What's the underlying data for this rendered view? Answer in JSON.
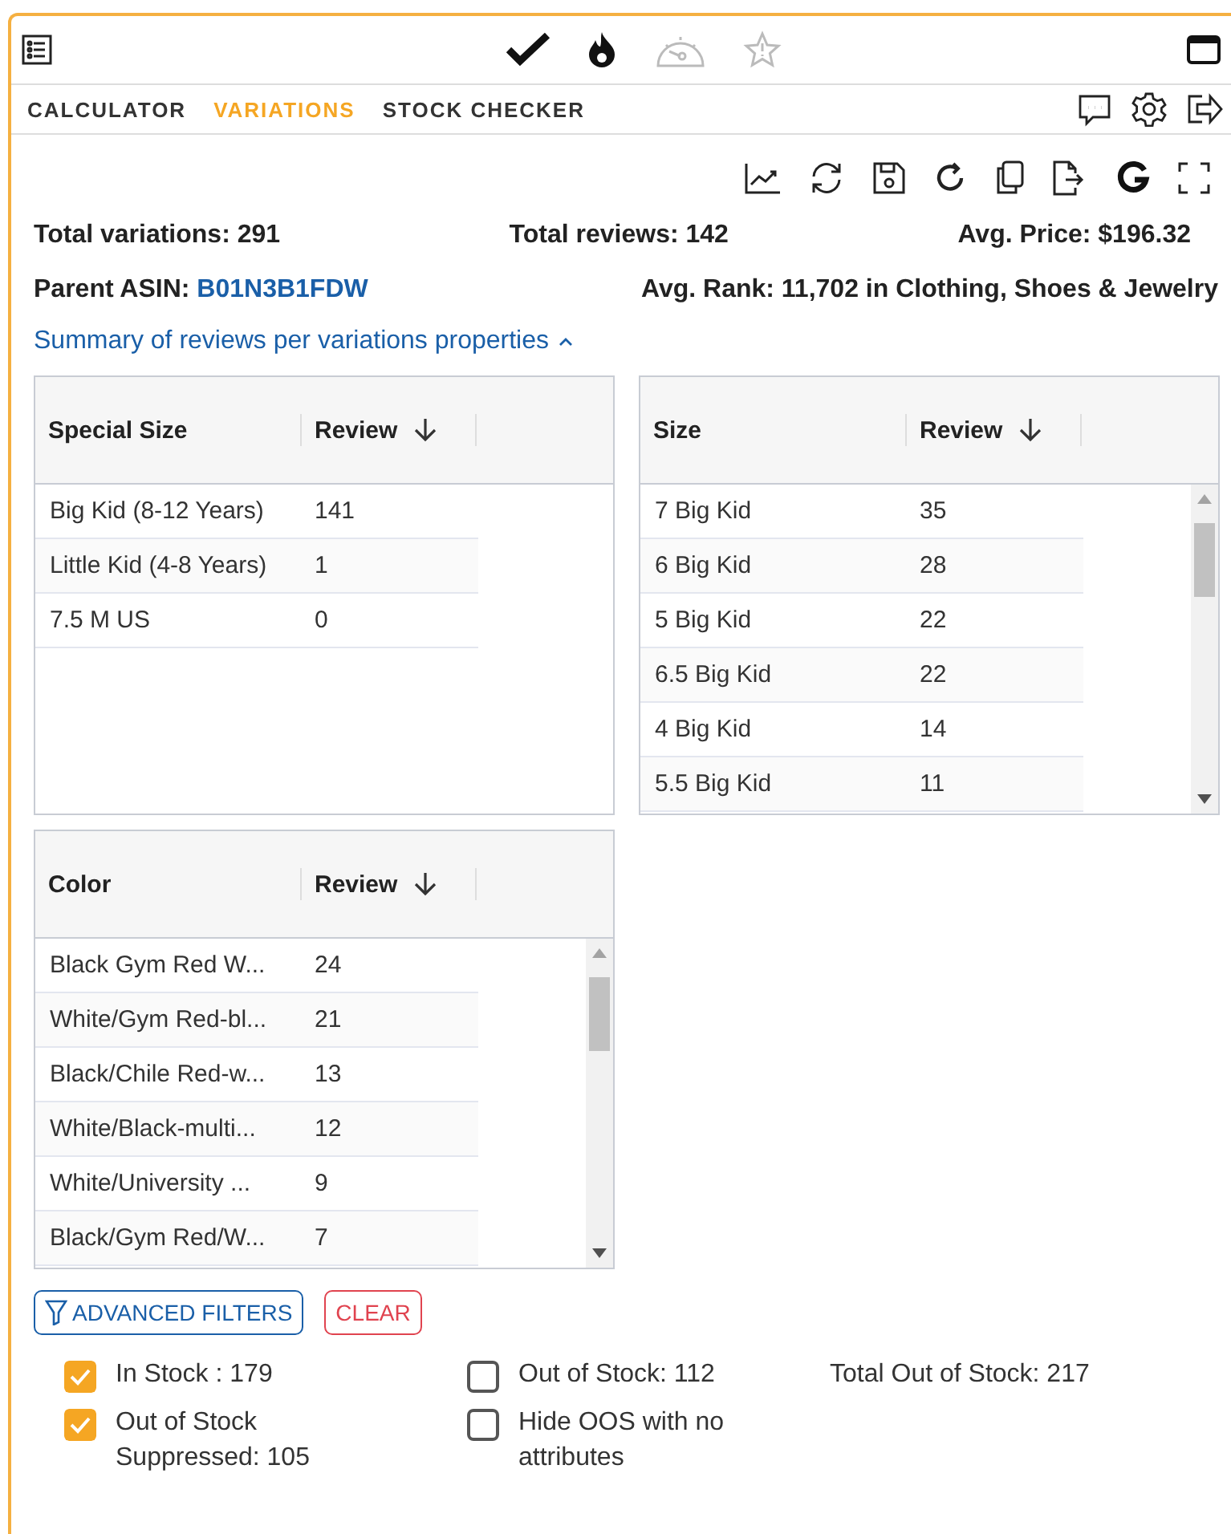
{
  "tabs": [
    {
      "label": "CALCULATOR",
      "selected": false
    },
    {
      "label": "VARIATIONS",
      "selected": true
    },
    {
      "label": "STOCK CHECKER",
      "selected": false
    }
  ],
  "stats": {
    "total_variations": "Total variations: 291",
    "total_reviews": "Total reviews: 142",
    "avg_price": "Avg. Price: $196.32",
    "parent_asin": {
      "label": "Parent ASIN:",
      "value": "B01N3B1FDW"
    },
    "avg_rank": "Avg. Rank: 11,702 in Clothing, Shoes & Jewelry"
  },
  "summary_toggle": {
    "label": "Summary of reviews per variations properties",
    "expanded": true
  },
  "tables": [
    {
      "columns": [
        "Special Size",
        "Review"
      ],
      "scrollable": false,
      "rows": [
        [
          "Big Kid (8-12 Years)",
          "141"
        ],
        [
          "Little Kid (4-8 Years)",
          "1"
        ],
        [
          "7.5 M US",
          "0"
        ]
      ]
    },
    {
      "columns": [
        "Size",
        "Review"
      ],
      "scrollable": true,
      "rows": [
        [
          "7 Big Kid",
          "35"
        ],
        [
          "6 Big Kid",
          "28"
        ],
        [
          "5 Big Kid",
          "22"
        ],
        [
          "6.5 Big Kid",
          "22"
        ],
        [
          "4 Big Kid",
          "14"
        ],
        [
          "5.5 Big Kid",
          "11"
        ]
      ]
    },
    {
      "columns": [
        "Color",
        "Review"
      ],
      "scrollable": true,
      "rows": [
        [
          "Black Gym Red W...",
          "24"
        ],
        [
          "White/Gym Red-bl...",
          "21"
        ],
        [
          "Black/Chile Red-w...",
          "13"
        ],
        [
          "White/Black-multi...",
          "12"
        ],
        [
          "White/University ...",
          "9"
        ],
        [
          "Black/Gym Red/W...",
          "7"
        ]
      ]
    }
  ],
  "buttons": [
    {
      "label": "ADVANCED FILTERS",
      "kind": "filter"
    },
    {
      "label": "CLEAR",
      "kind": "clear"
    }
  ],
  "filters": [
    {
      "label": "In Stock : 179",
      "checked": true
    },
    {
      "label": "Out of Stock: 112",
      "checked": false
    },
    {
      "label": "Out of Stock Suppressed: 105",
      "checked": true
    },
    {
      "label": "Hide OOS with no attributes",
      "checked": false
    }
  ],
  "total_out_of_stock": "Total Out of Stock: 217"
}
